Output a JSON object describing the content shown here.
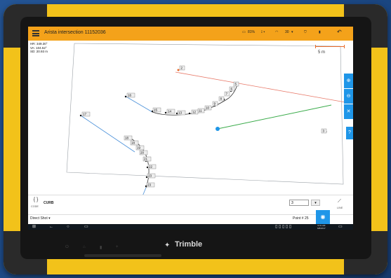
{
  "app": {
    "title": "Arista intersection 11152036",
    "status": {
      "battery": "81%",
      "satellites": "30"
    }
  },
  "readout": {
    "hr": "HR: 349.30°",
    "va": "VA: 104.52°",
    "sd": "SD: 20.93 m"
  },
  "scale_label": "5 m",
  "points": [
    "1",
    "2",
    "3",
    "4",
    "5",
    "6",
    "7",
    "8",
    "9",
    "10",
    "11",
    "12",
    "13",
    "14",
    "15",
    "16",
    "17",
    "18",
    "19",
    "20",
    "21",
    "22",
    "23",
    "24"
  ],
  "bottom": {
    "code_label": "CODE",
    "curb": "CURB",
    "input_value": "3",
    "line_label": "LINE",
    "method": "Direct Shot",
    "point_label": "Point # 25"
  },
  "taskbar": {
    "time": "9:31 AM",
    "date": "6/8/2017"
  },
  "brand": "Trimble",
  "colors": {
    "accent": "#1f96e8",
    "appbar": "#f4a21a",
    "case": "#f2c21a"
  }
}
